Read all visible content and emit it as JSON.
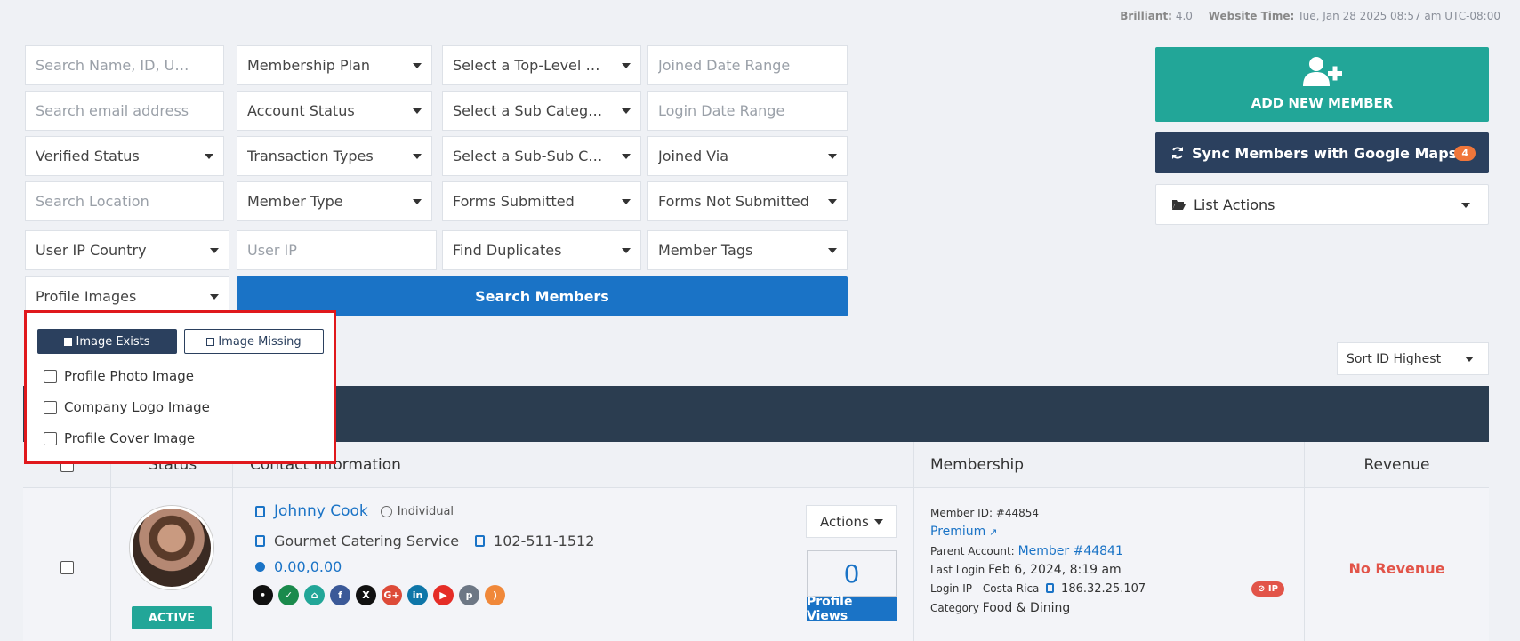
{
  "header": {
    "brilliant_label": "Brilliant:",
    "brilliant_value": "4.0",
    "time_label": "Website Time:",
    "time_value": "Tue, Jan 28 2025 08:57 am UTC-08:00"
  },
  "filters": {
    "search_name_placeholder": "Search Name, ID, URL or To",
    "membership_plan": "Membership Plan",
    "top_category": "Select a Top-Level Cat...",
    "joined_date_placeholder": "Joined Date Range",
    "search_email_placeholder": "Search email address",
    "account_status": "Account Status",
    "sub_category": "Select a Sub Category",
    "login_date_placeholder": "Login Date Range",
    "verified_status": "Verified Status",
    "transaction_types": "Transaction Types",
    "sub_sub_category": "Select a Sub-Sub Cate...",
    "joined_via": "Joined Via",
    "search_location_placeholder": "Search Location",
    "member_type": "Member Type",
    "forms_submitted": "Forms Submitted",
    "forms_not_submitted": "Forms Not Submitted",
    "user_ip_country": "User IP Country",
    "user_ip_placeholder": "User IP",
    "find_duplicates": "Find Duplicates",
    "member_tags": "Member Tags",
    "profile_images": "Profile Images",
    "search_button": "Search Members"
  },
  "profile_images_popup": {
    "image_exists": "Image Exists",
    "image_missing": "Image Missing",
    "options": [
      "Profile Photo Image",
      "Company Logo Image",
      "Profile Cover Image"
    ]
  },
  "side": {
    "add_member": "ADD NEW MEMBER",
    "sync": "Sync Members with Google Maps",
    "sync_count": "4",
    "list_actions": "List Actions",
    "sort": "Sort ID Highest"
  },
  "table": {
    "columns": {
      "status": "Status",
      "contact": "Contact Information",
      "membership": "Membership",
      "revenue": "Revenue"
    },
    "row": {
      "status": "ACTIVE",
      "name": "Johnny Cook",
      "type": "Individual",
      "company": "Gourmet Catering Service",
      "phone": "102-511-1512",
      "coords": "0.00,0.00",
      "actions": "Actions",
      "views": "0",
      "views_label": "Profile Views",
      "member_id_label": "Member ID:",
      "member_id": "#44854",
      "plan": "Premium",
      "parent_label": "Parent Account:",
      "parent": "Member #44841",
      "last_login_label": "Last Login",
      "last_login": "Feb 6, 2024, 8:19 am",
      "login_ip_label": "Login IP - Costa Rica",
      "login_ip": "186.32.25.107",
      "category_label": "Category",
      "category": "Food & Dining",
      "ip_badge": "IP",
      "revenue": "No Revenue"
    }
  },
  "colors": {
    "teal": "#22a698",
    "navy": "#2b405e",
    "blue": "#1a73c6",
    "red": "#e25449",
    "highlight": "#e0181c"
  }
}
